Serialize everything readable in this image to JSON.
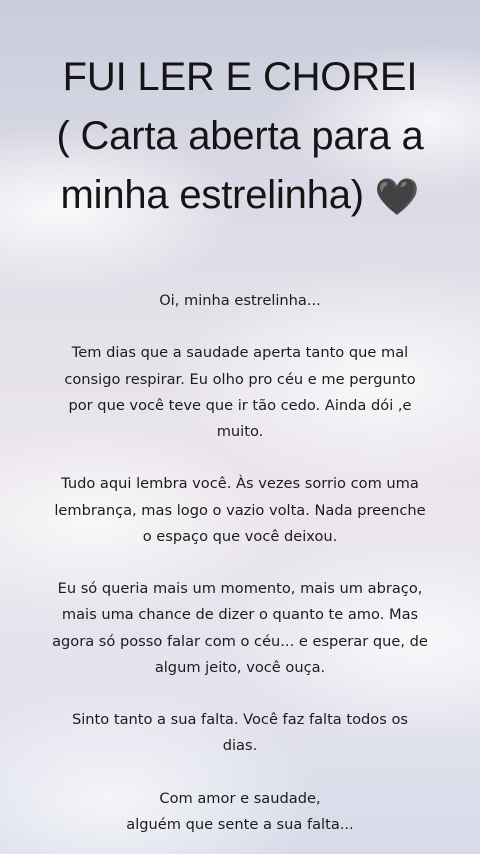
{
  "title": {
    "line1": "FUI LER E CHOREI",
    "line2": "( Carta aberta para a",
    "line3": "minha estrelinha)",
    "heart": "🖤"
  },
  "letter": {
    "greeting": "Oi, minha estrelinha...",
    "p1": [
      "Tem dias que a saudade aperta tanto que mal",
      "consigo respirar. Eu olho pro céu e me pergunto",
      "por que você teve que ir tão cedo. Ainda dói ,e",
      "muito."
    ],
    "p2": [
      "Tudo aqui lembra você. Às vezes sorrio com uma",
      "lembrança, mas logo o vazio volta. Nada preenche",
      "o espaço que você deixou."
    ],
    "p3": [
      "Eu só queria mais um momento, mais um abraço,",
      "mais uma chance de dizer o quanto te amo. Mas",
      "agora só posso falar com o céu... e esperar que, de",
      "algum jeito, você ouça."
    ],
    "p4": [
      "Sinto tanto a sua falta. Você faz falta todos os",
      "dias."
    ],
    "closing": [
      "Com amor e saudade,",
      "alguém que sente a sua falta..."
    ]
  }
}
